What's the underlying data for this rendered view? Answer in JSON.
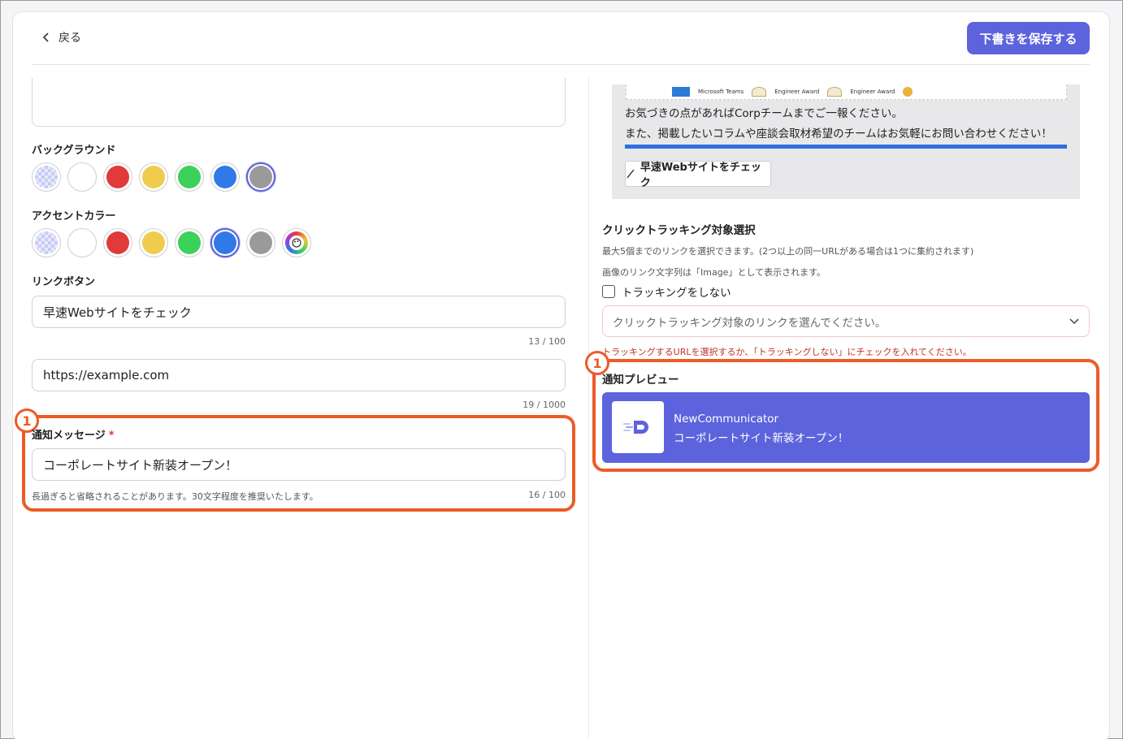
{
  "header": {
    "back_label": "戻る",
    "save_label": "下書きを保存する"
  },
  "colors": {
    "accent": "#5c63dc",
    "callout": "#ec5b28",
    "swatch_red": "#e03a3a",
    "swatch_yellow": "#f0cc4e",
    "swatch_green": "#3bd15a",
    "swatch_blue": "#2f7ae8",
    "swatch_gray": "#9a9a9a"
  },
  "left": {
    "background_label": "バックグラウンド",
    "background_swatches": [
      "transparent",
      "white",
      "red",
      "yellow",
      "green",
      "blue",
      "gray"
    ],
    "background_selected": "gray",
    "accent_label": "アクセントカラー",
    "accent_swatches": [
      "transparent",
      "white",
      "red",
      "yellow",
      "green",
      "blue",
      "gray",
      "custom"
    ],
    "accent_selected": "blue",
    "link_button_label": "リンクボタン",
    "link_button_text": "早速Webサイトをチェック",
    "link_button_text_count": "13 / 100",
    "link_url": "https://example.com",
    "link_url_count": "19 / 1000",
    "notif_message_label": "通知メッセージ",
    "notif_required_mark": "*",
    "notif_message_value": "コーポレートサイト新装オープン！",
    "notif_message_hint": "長過ぎると省略されることがあります。30文字程度を推奨いたします。",
    "notif_message_count": "16 / 100",
    "callout_number": "1"
  },
  "right": {
    "badges": [
      "Microsoft Teams",
      "Engineer Award",
      "Engineer Award"
    ],
    "preview_line1": "お気づきの点があればCorpチームまでご一報ください。",
    "preview_line2": "また、掲載したいコラムや座談会取材希望のチームはお気軽にお問い合わせください！",
    "preview_button": "早速Webサイトをチェック",
    "tracking_label": "クリックトラッキング対象選択",
    "tracking_hint1": "最大5個までのリンクを選択できます。(2つ以上の同一URLがある場合は1つに集約されます)",
    "tracking_hint2": "画像のリンク文字列は「Image」として表示されます。",
    "no_tracking_label": "トラッキングをしない",
    "no_tracking_checked": false,
    "select_placeholder": "クリックトラッキング対象のリンクを選んでください。",
    "error_text": "トラッキングするURLを選択するか、「トラッキングしない」にチェックを入れてください。",
    "notif_preview_label": "通知プレビュー",
    "notif_app_name": "NewCommunicator",
    "notif_message": "コーポレートサイト新装オープン！",
    "callout_number": "1"
  }
}
